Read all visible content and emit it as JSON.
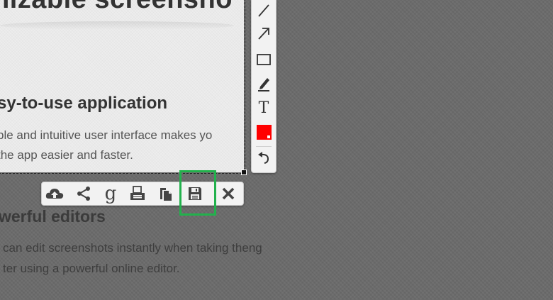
{
  "page": {
    "title": "nizable screensho",
    "section1": {
      "heading": "sy-to-use application",
      "lines": [
        "ple and intuitive user interface makes yo",
        " the app easier and faster."
      ]
    },
    "section2": {
      "heading": "werful editors",
      "lines": [
        "can edit screenshots instantly when taking theng",
        "ter using a powerful online editor."
      ]
    }
  },
  "tools": {
    "vertical": [
      {
        "name": "line-tool",
        "icon": "line-icon"
      },
      {
        "name": "arrow-tool",
        "icon": "arrow-icon"
      },
      {
        "name": "rectangle-tool",
        "icon": "rectangle-icon"
      },
      {
        "name": "pen-tool",
        "icon": "pen-icon"
      },
      {
        "name": "text-tool",
        "icon": "text-icon",
        "label": "T"
      },
      {
        "name": "color-picker",
        "icon": "color-swatch-icon",
        "color": "#ff0000"
      },
      {
        "name": "undo-tool",
        "icon": "undo-icon"
      }
    ],
    "horizontal": [
      {
        "name": "upload",
        "icon": "cloud-upload-icon"
      },
      {
        "name": "share",
        "icon": "share-icon"
      },
      {
        "name": "google-search",
        "icon": "google-icon",
        "label": "g"
      },
      {
        "name": "print",
        "icon": "printer-icon"
      },
      {
        "name": "copy",
        "icon": "copy-icon"
      },
      {
        "name": "save",
        "icon": "save-icon"
      },
      {
        "name": "close",
        "icon": "close-icon"
      }
    ]
  },
  "colors": {
    "background": "#6b6b6b",
    "selection": "#ededed",
    "highlight": "#22b14c",
    "active_color": "#ff0000"
  }
}
